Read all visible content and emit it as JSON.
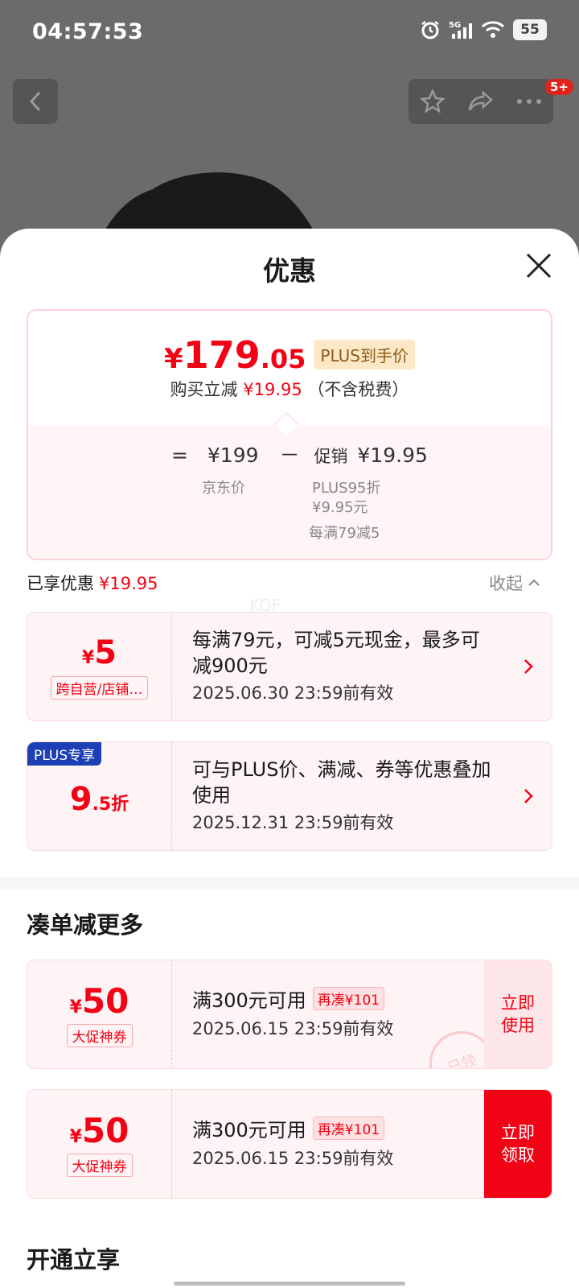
{
  "status_bar": {
    "time": "04:57:53",
    "battery": "55",
    "network": "5G"
  },
  "nav": {
    "badge": "5+"
  },
  "sheet": {
    "title": "优惠"
  },
  "price_card": {
    "currency": "¥",
    "price_int": "179",
    "price_dec": ".05",
    "plus_tag": "PLUS到手价",
    "sub_prefix": "购买立减",
    "sub_amount": "¥19.95",
    "sub_suffix": "（不含税费）",
    "calc_eq": "=",
    "jd_price": "¥199",
    "minus": "－",
    "promo_label": "促销",
    "promo_amount": "¥19.95",
    "jd_price_label": "京东价",
    "promo_detail_1": "PLUS95折",
    "promo_detail_2": "¥9.95元",
    "promo_detail_3": "每满79减5"
  },
  "enjoyed": {
    "label": "已享优惠",
    "amount": "¥19.95",
    "collapse": "收起"
  },
  "watermark": "KOF",
  "discounts": [
    {
      "amount_prefix": "¥",
      "amount": "5",
      "tag": "跨自营/店铺…",
      "desc": "每满79元，可减5元现金，最多可减900元",
      "date": "2025.06.30 23:59前有效"
    },
    {
      "corner": "PLUS专享",
      "amount": "9",
      "amount_suffix": ".5折",
      "desc": "可与PLUS价、满减、券等优惠叠加使用",
      "date": "2025.12.31 23:59前有效"
    }
  ],
  "more_section": {
    "title": "凑单减更多"
  },
  "coupons": [
    {
      "amount_prefix": "¥",
      "amount": "50",
      "tag": "大促神券",
      "condition": "满300元可用",
      "more": "再凑¥101",
      "date": "2025.06.15 23:59前有效",
      "button": "立即使用",
      "stamp": "已领"
    },
    {
      "amount_prefix": "¥",
      "amount": "50",
      "tag": "大促神券",
      "condition": "满300元可用",
      "more": "再凑¥101",
      "date": "2025.06.15 23:59前有效",
      "button": "立即领取"
    }
  ],
  "bottom_section": {
    "title": "开通立享"
  },
  "colors": {
    "accent": "#f10215",
    "plus_blue": "#1d3fb5",
    "plus_gold": "#fce8c6"
  }
}
